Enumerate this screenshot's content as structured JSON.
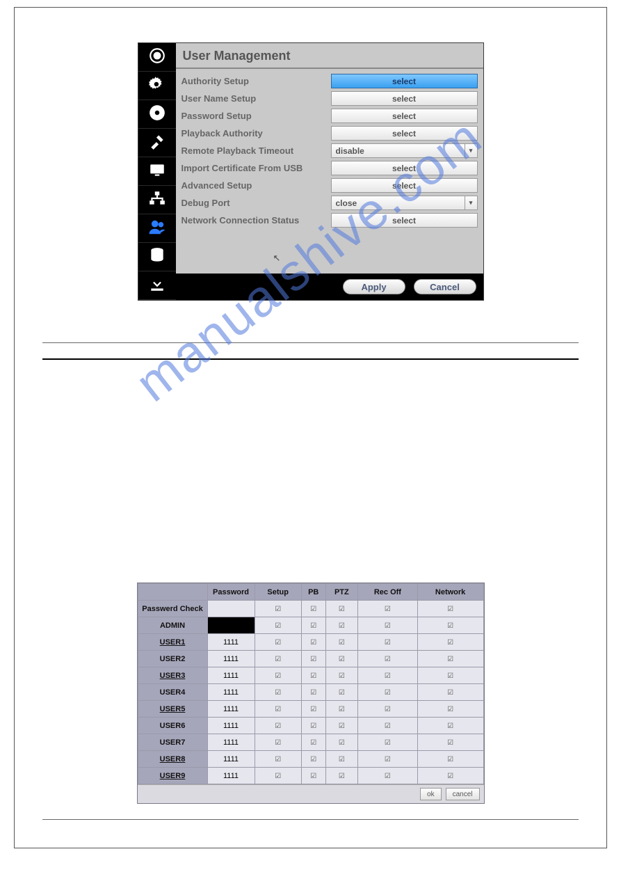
{
  "watermark": "manualshive.com",
  "dialog": {
    "title": "User  Management",
    "rows": [
      {
        "label": "Authority  Setup",
        "type": "button",
        "value": "select",
        "highlight": true
      },
      {
        "label": "User  Name  Setup",
        "type": "button",
        "value": "select"
      },
      {
        "label": "Password  Setup",
        "type": "button",
        "value": "select"
      },
      {
        "label": "Playback  Authority",
        "type": "button",
        "value": "select"
      },
      {
        "label": "Remote  Playback  Timeout",
        "type": "combo",
        "value": "disable"
      },
      {
        "label": "Import  Certificate  From  USB",
        "type": "button",
        "value": "select"
      },
      {
        "label": "Advanced  Setup",
        "type": "button",
        "value": "select"
      },
      {
        "label": "Debug  Port",
        "type": "combo",
        "value": "close"
      },
      {
        "label": "Network  Connection  Status",
        "type": "button",
        "value": "select"
      }
    ],
    "footer": {
      "apply": "Apply",
      "cancel": "Cancel"
    }
  },
  "auth_table": {
    "headers": [
      "",
      "Password",
      "Setup",
      "PB",
      "PTZ",
      "Rec Off",
      "Network"
    ],
    "rows": [
      {
        "name": "Passwerd Check",
        "pwd": "",
        "pwd_black": false,
        "linked": false
      },
      {
        "name": "ADMIN",
        "pwd": "",
        "pwd_black": true,
        "linked": false
      },
      {
        "name": "USER1",
        "pwd": "1111",
        "pwd_black": false,
        "linked": true
      },
      {
        "name": "USER2",
        "pwd": "1111",
        "pwd_black": false,
        "linked": false
      },
      {
        "name": "USER3",
        "pwd": "1111",
        "pwd_black": false,
        "linked": true
      },
      {
        "name": "USER4",
        "pwd": "1111",
        "pwd_black": false,
        "linked": false
      },
      {
        "name": "USER5",
        "pwd": "1111",
        "pwd_black": false,
        "linked": true
      },
      {
        "name": "USER6",
        "pwd": "1111",
        "pwd_black": false,
        "linked": false
      },
      {
        "name": "USER7",
        "pwd": "1111",
        "pwd_black": false,
        "linked": false
      },
      {
        "name": "USER8",
        "pwd": "1111",
        "pwd_black": false,
        "linked": true
      },
      {
        "name": "USER9",
        "pwd": "1111",
        "pwd_black": false,
        "linked": true
      }
    ],
    "footer": {
      "ok": "ok",
      "cancel": "cancel"
    }
  },
  "sidebar_icons": [
    "camera",
    "gears",
    "disc",
    "tools",
    "monitor",
    "network",
    "users",
    "database",
    "download"
  ]
}
